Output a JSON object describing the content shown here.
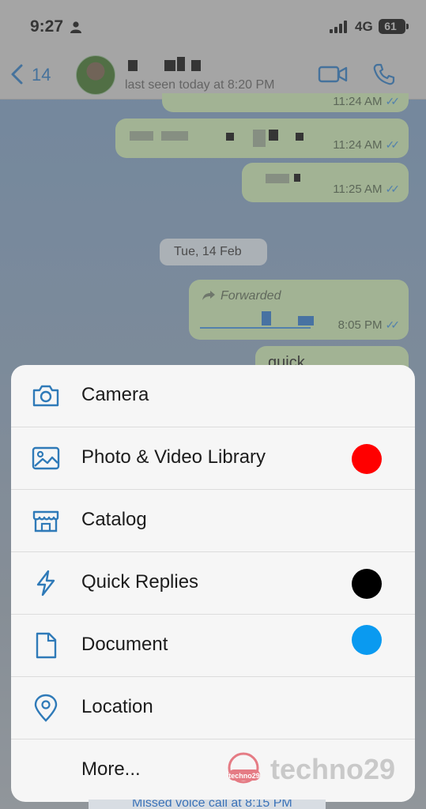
{
  "status_bar": {
    "time": "9:27",
    "network": "4G",
    "battery": "61"
  },
  "header": {
    "back_count": "14",
    "last_seen": "last seen today at 8:20 PM"
  },
  "messages": [
    {
      "time": "11:24 AM"
    },
    {
      "time": "11:24 AM"
    },
    {
      "time": "11:25 AM",
      "text": "11:00"
    },
    {
      "date_chip": "Tue, 14 Feb"
    },
    {
      "forwarded_label": "Forwarded",
      "time": "8:05 PM"
    },
    {
      "text": "quick"
    }
  ],
  "attach_menu": {
    "items": [
      {
        "label": "Camera",
        "icon": "camera-icon"
      },
      {
        "label": "Photo & Video Library",
        "icon": "photo-library-icon",
        "dot_color": "#ff0000"
      },
      {
        "label": "Catalog",
        "icon": "catalog-store-icon"
      },
      {
        "label": "Quick Replies",
        "icon": "lightning-icon",
        "dot_color": "#000000"
      },
      {
        "label": "Document",
        "icon": "document-icon",
        "dot_color": "#0a9af0"
      },
      {
        "label": "Location",
        "icon": "location-pin-icon"
      },
      {
        "label": "More..."
      }
    ]
  },
  "watermark": {
    "text": "techno29",
    "logo_text": "techno29"
  },
  "footer_strip": {
    "text": "Missed voice call at 8:15 PM"
  },
  "colors": {
    "accent": "#2a6fb0",
    "bubble": "#b8d3a3",
    "icon": "#2f7ab8"
  }
}
